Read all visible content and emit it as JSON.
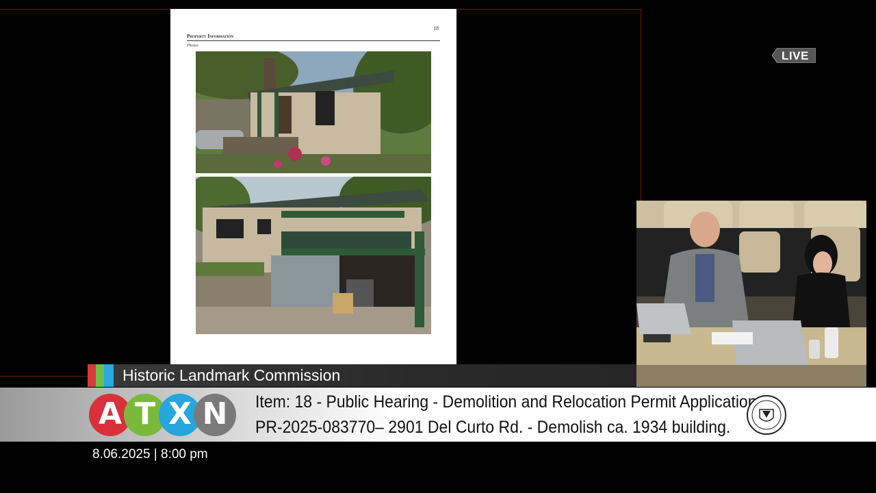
{
  "document": {
    "page_number": "18",
    "section_heading": "Property Information",
    "sub_heading": "Photos"
  },
  "live_badge": {
    "label": "LIVE"
  },
  "lower_third": {
    "program_title": "Historic Landmark Commission",
    "color_bars": [
      "#d63a3a",
      "#6cc04a",
      "#2aa8e0"
    ],
    "logo": {
      "letters": [
        "A",
        "T",
        "X",
        "N"
      ],
      "colors": [
        "#d8313b",
        "#7ab93b",
        "#25a6dd",
        "#7a7a7a"
      ]
    },
    "item_line_1": "Item: 18 - Public Hearing - Demolition and Relocation Permit Application",
    "item_line_2": "PR-2025-083770– 2901 Del Curto Rd. - Demolish ca. 1934 building.",
    "seal_icon": "city-of-austin-seal-icon",
    "timestamp": "8.06.2025 | 8:00 pm"
  }
}
